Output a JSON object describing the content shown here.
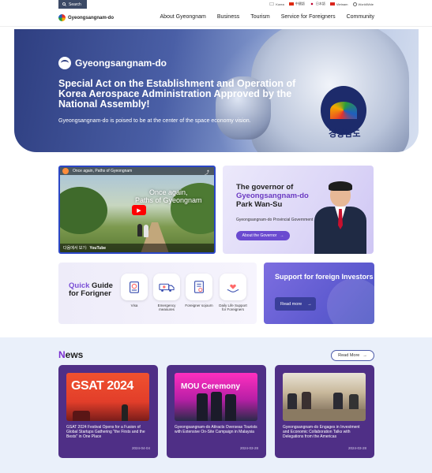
{
  "topbar": {
    "search_label": "Search",
    "languages": [
      "Korea",
      "中國語",
      "日本語",
      "Vietnam",
      "WorldWide"
    ]
  },
  "header": {
    "logo_text": "Gyeongsangnam-do",
    "nav": [
      "About Gyeongnam",
      "Business",
      "Tourism",
      "Service for Foreigners",
      "Community"
    ]
  },
  "hero": {
    "brand": "Gyeongsangnam-do",
    "title": "Special Act on the Establishment and Operation of Korea Aerospace Administration Approved by the National Assembly!",
    "subtitle": "Gyeongsangnam-do is poised to be at the center of the space economy vision.",
    "patch_text": "경상남도"
  },
  "video": {
    "channel_title": "Once again, Paths of Gyeongnam",
    "caption": "Once again,\nPaths of Gyeongnam",
    "watch_on": "다음에서 보기:",
    "youtube": "YouTube"
  },
  "governor": {
    "title_prefix": "The governor of",
    "title_accent": "Gyeongsangnam-do",
    "name": "Park Wan-Su",
    "subtitle": "Gyeongsangnam-do Provincial Government",
    "button": "About the Governor"
  },
  "quick_guide": {
    "title_accent": "Quick",
    "title_rest": " Guide",
    "title_line2": "for Forigner",
    "items": [
      {
        "label": "Visa",
        "icon": "passport-icon"
      },
      {
        "label": "Emergency measures",
        "icon": "ambulance-icon"
      },
      {
        "label": "Foreigner sojourn",
        "icon": "document-icon"
      },
      {
        "label": "Daily Life Support for Foreigners",
        "icon": "support-hands-icon"
      }
    ]
  },
  "support": {
    "title": "Support for foreign Investors",
    "button": "Read more"
  },
  "news": {
    "heading_first": "N",
    "heading_rest": "ews",
    "more": "Read More",
    "items": [
      {
        "text": "GSAT 2024 Festival Opens for a Fusion of Global Startups Gathering \"the Firsts and the Bests\" in One Place",
        "date": "2024-04-04",
        "image_text": "GSAT 2024"
      },
      {
        "text": "Gyeongsangnam-do Attracts Overseas Tourists with Extensive On-Site Campaign in Malaysia",
        "date": "2024-03-28",
        "image_text": "MOU Ceremony"
      },
      {
        "text": "Gyeongsangnam-do Engages in Investment and Economic Collaboration Talks with Delegations from the Americas",
        "date": "2024-03-28",
        "image_text": ""
      }
    ]
  },
  "colors": {
    "accent_purple": "#6a4ad0",
    "news_card": "#4f2f86",
    "hero_blue": "#2e3e80"
  }
}
